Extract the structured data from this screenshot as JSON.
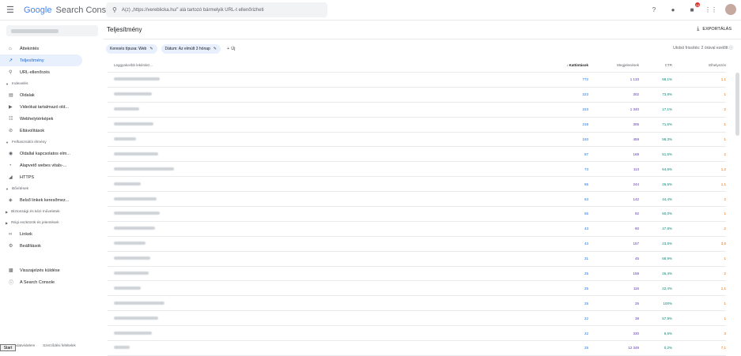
{
  "topbar": {
    "logo_google": "Google",
    "logo_product": "Search Console",
    "search_placeholder": "A(z) „https://vereblicka.hu/” alá tartozó bármelyik URL-t ellenőrizheti",
    "notification_count": "10"
  },
  "sidebar": {
    "items": [
      {
        "label": "Áttekintés",
        "icon": "home-icon"
      },
      {
        "label": "Teljesítmény",
        "icon": "trending-icon",
        "active": true
      },
      {
        "label": "URL-ellenőrzés",
        "icon": "search-icon"
      }
    ],
    "section_indexing": "Indexelés",
    "indexing_items": [
      {
        "label": "Oldalak",
        "icon": "pages-icon"
      },
      {
        "label": "Videókat tartalmazó old...",
        "icon": "video-icon"
      },
      {
        "label": "Webhelytérképek",
        "icon": "sitemap-icon"
      },
      {
        "label": "Eltávolítások",
        "icon": "removal-icon"
      }
    ],
    "section_experience": "Felhasználói élmény",
    "experience_items": [
      {
        "label": "Oldallal kapcsolatos elm...",
        "icon": "experience-icon"
      },
      {
        "label": "Alapvető webes vitals-...",
        "icon": "vitals-icon"
      },
      {
        "label": "HTTPS",
        "icon": "lock-icon"
      }
    ],
    "section_enhancements": "Bővítések",
    "enhancement_items": [
      {
        "label": "Belső linkek keresőmez...",
        "icon": "sitelinks-icon"
      }
    ],
    "section_security": "Biztonsági és kézi műveletek",
    "section_legacy": "Régi eszközök és jelentések",
    "bottom_items": [
      {
        "label": "Linkek",
        "icon": "links-icon"
      },
      {
        "label": "Beállítások",
        "icon": "settings-icon"
      }
    ],
    "footer_items": [
      {
        "label": "Visszajelzés küldése",
        "icon": "feedback-icon"
      },
      {
        "label": "A Search Console",
        "icon": "info-icon"
      }
    ],
    "footer_links": [
      "Adatvédelem",
      "Szerződési feltételek"
    ]
  },
  "start_button": "Start",
  "page": {
    "title": "Teljesítmény",
    "export_label": "EXPORTÁLÁS",
    "updated": "Utolsó frissítés: 2 órával ezelőtt"
  },
  "filters": {
    "search_type": "Keresés típusa: Web",
    "date": "Dátum: Az elmúlt 3 hónap",
    "new_label": "Új"
  },
  "table": {
    "headers": [
      "Leggyakoribb lekérdez...",
      "Kattintások",
      "Megjelenések",
      "CTR",
      "Elhelyezés"
    ],
    "rows": [
      {
        "clicks": "772",
        "impressions": "1 133",
        "ctr": "68,1%",
        "position": "1,1"
      },
      {
        "clicks": "223",
        "impressions": "302",
        "ctr": "73,8%",
        "position": "1"
      },
      {
        "clicks": "223",
        "impressions": "1 340",
        "ctr": "17,1%",
        "position": "2"
      },
      {
        "clicks": "219",
        "impressions": "306",
        "ctr": "71,6%",
        "position": "1"
      },
      {
        "clicks": "193",
        "impressions": "459",
        "ctr": "58,3%",
        "position": "1"
      },
      {
        "clicks": "87",
        "impressions": "169",
        "ctr": "51,5%",
        "position": "2"
      },
      {
        "clicks": "73",
        "impressions": "113",
        "ctr": "64,6%",
        "position": "1,2"
      },
      {
        "clicks": "65",
        "impressions": "244",
        "ctr": "26,6%",
        "position": "1,1"
      },
      {
        "clicks": "63",
        "impressions": "142",
        "ctr": "44,4%",
        "position": "2"
      },
      {
        "clicks": "55",
        "impressions": "92",
        "ctr": "60,0%",
        "position": "1"
      },
      {
        "clicks": "43",
        "impressions": "90",
        "ctr": "47,8%",
        "position": "2"
      },
      {
        "clicks": "43",
        "impressions": "157",
        "ctr": "23,5%",
        "position": "3,6"
      },
      {
        "clicks": "31",
        "impressions": "45",
        "ctr": "68,9%",
        "position": "1"
      },
      {
        "clicks": "25",
        "impressions": "159",
        "ctr": "26,4%",
        "position": "2"
      },
      {
        "clicks": "25",
        "impressions": "116",
        "ctr": "22,4%",
        "position": "1,1"
      },
      {
        "clicks": "25",
        "impressions": "25",
        "ctr": "100%",
        "position": "1"
      },
      {
        "clicks": "22",
        "impressions": "38",
        "ctr": "57,9%",
        "position": "1"
      },
      {
        "clicks": "22",
        "impressions": "330",
        "ctr": "6,6%",
        "position": "3"
      },
      {
        "clicks": "25",
        "impressions": "12 349",
        "ctr": "0,2%",
        "position": "7,1"
      }
    ]
  }
}
